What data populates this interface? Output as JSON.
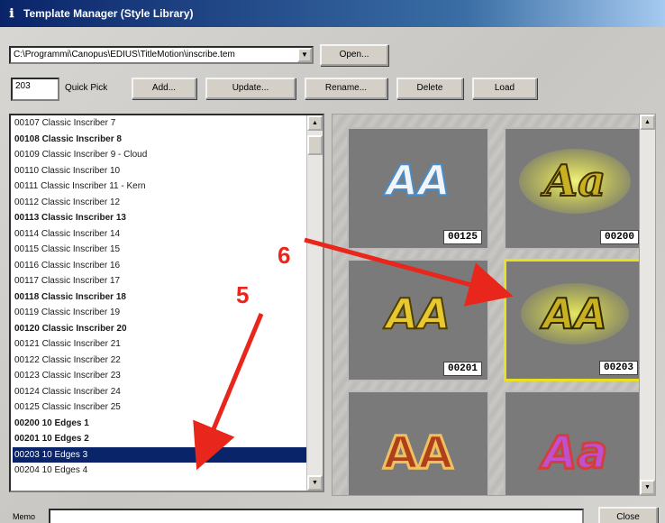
{
  "window": {
    "title": "Template Manager (Style Library)"
  },
  "path": {
    "value": "C:\\Programmi\\Canopus\\EDIUS\\TitleMotion\\inscribe.tem"
  },
  "buttons": {
    "open": "Open...",
    "add": "Add...",
    "update": "Update...",
    "rename": "Rename...",
    "delete": "Delete",
    "load": "Load",
    "close": "Close"
  },
  "quickpick": {
    "value": "203",
    "label": "Quick Pick"
  },
  "list": {
    "items": [
      "00107 Classic Inscriber 7",
      "00108 Classic Inscriber 8",
      "00109 Classic Inscriber 9 - Cloud",
      "00110 Classic Inscriber 10",
      "00111 Classic Inscriber 11 - Kern",
      "00112 Classic Inscriber 12",
      "00113 Classic Inscriber 13",
      "00114 Classic Inscriber 14",
      "00115 Classic Inscriber 15",
      "00116 Classic Inscriber 16",
      "00117 Classic Inscriber 17",
      "00118 Classic Inscriber 18",
      "00119 Classic Inscriber 19",
      "00120 Classic Inscriber 20",
      "00121 Classic Inscriber 21",
      "00122 Classic Inscriber 22",
      "00123 Classic Inscriber 23",
      "00124 Classic Inscriber 24",
      "00125 Classic Inscriber 25",
      "00200 10 Edges 1",
      "00201 10 Edges 2",
      "00203 10 Edges 3",
      "00204 10 Edges 4"
    ],
    "selected": "00203 10 Edges 3"
  },
  "gallery": {
    "thumbnails": [
      {
        "code": "00125",
        "text": "AA"
      },
      {
        "code": "00200",
        "text": "Aa"
      },
      {
        "code": "00201",
        "text": "AA"
      },
      {
        "code": "00203",
        "text": "AA",
        "selected": true
      },
      {
        "code": "",
        "text": "AA"
      },
      {
        "code": "",
        "text": "Aa"
      }
    ]
  },
  "memo": {
    "label": "Memo"
  },
  "annotations": {
    "step5": "5",
    "step6": "6",
    "color": "#e8261b"
  }
}
